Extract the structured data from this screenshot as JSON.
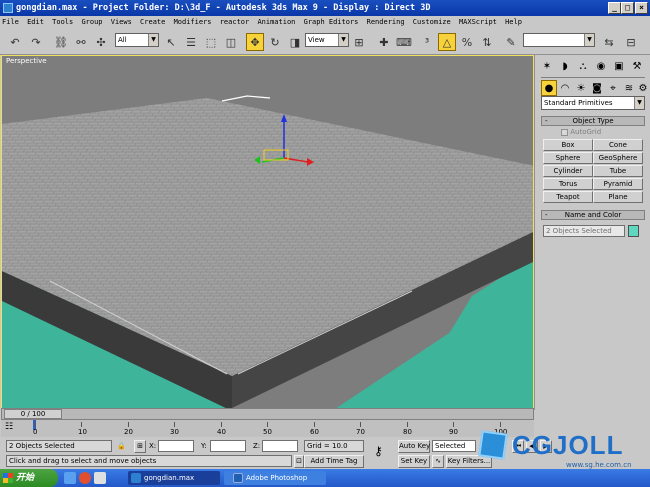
{
  "window": {
    "title": "gongdian.max     - Project Folder: D:\\3d_F       - Autodesk 3ds Max 9           - Display : Direct 3D"
  },
  "menu": [
    "File",
    "Edit",
    "Tools",
    "Group",
    "Views",
    "Create",
    "Modifiers",
    "reactor",
    "Animation",
    "Graph Editors",
    "Rendering",
    "Customize",
    "MAXScript",
    "Help"
  ],
  "toolbar": {
    "selection_filter": "All",
    "ref_coord": "View"
  },
  "viewport": {
    "label": "Perspective"
  },
  "command_panel": {
    "category": "Standard Primitives",
    "object_type_title": "Object Type",
    "autogrid": "AutoGrid",
    "buttons": [
      "Box",
      "Cone",
      "Sphere",
      "GeoSphere",
      "Cylinder",
      "Tube",
      "Torus",
      "Pyramid",
      "Teapot",
      "Plane"
    ],
    "name_color_title": "Name and Color",
    "name_value": "2 Objects Selected",
    "swatch_color": "#5fd7c0"
  },
  "timeline": {
    "slider_label": "0 / 100",
    "ticks": [
      "0",
      "10",
      "20",
      "30",
      "40",
      "50",
      "60",
      "70",
      "80",
      "90",
      "100"
    ]
  },
  "status": {
    "selection": "2 Objects Selected",
    "prompt": "Click and drag to select and move objects",
    "x_label": "X:",
    "y_label": "Y:",
    "z_label": "Z:",
    "grid": "Grid = 10.0",
    "add_time_tag": "Add Time Tag",
    "auto_key": "Auto Key",
    "set_key": "Set Key",
    "key_mode": "Selected",
    "key_filters": "Key Filters..."
  },
  "taskbar": {
    "start": "开始",
    "tasks": [
      "gongdian.max",
      "",
      "Adobe Photoshop"
    ]
  },
  "watermark": {
    "brand": "CGJOLL",
    "url": "www.sg.he.com.cn"
  },
  "colors": {
    "ground": "#3eb59a",
    "viewport_bg": "#7d7d7d",
    "accent": "#f7d23b"
  }
}
